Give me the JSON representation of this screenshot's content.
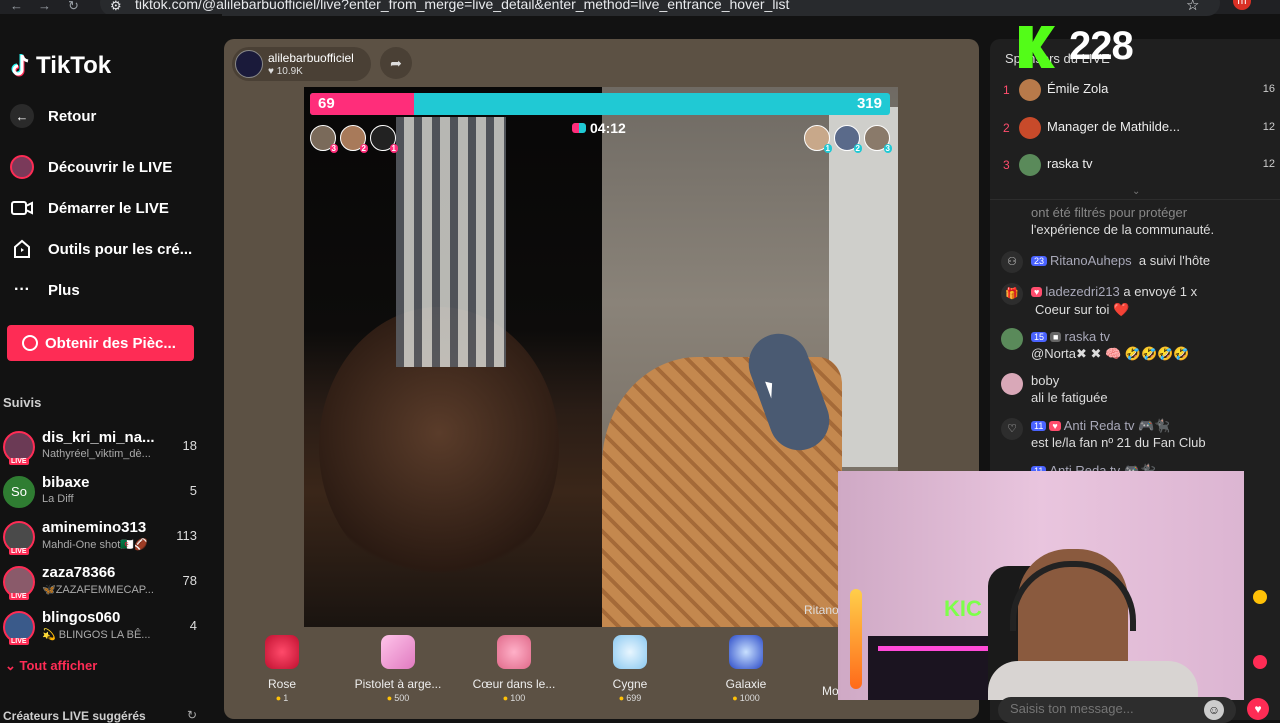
{
  "browser": {
    "url": "tiktok.com/@alilebarbuofficiel/live?enter_from_merge=live_detail&enter_method=live_entrance_hover_list",
    "profile_initial": "m"
  },
  "sidebar": {
    "logo": "TikTok",
    "nav": [
      {
        "label": "Retour",
        "icon": "arrow-left-icon"
      },
      {
        "label": "Découvrir le LIVE",
        "icon": "live-discover-icon"
      },
      {
        "label": "Démarrer le LIVE",
        "icon": "video-camera-icon"
      },
      {
        "label": "Outils pour les cré...",
        "icon": "creator-tools-icon"
      },
      {
        "label": "Plus",
        "icon": "more-dots-icon"
      }
    ],
    "coins_button": "Obtenir des Pièc...",
    "following_title": "Suivis",
    "following": [
      {
        "name": "dis_kri_mi_na...",
        "sub": "Nathyréel_viktim_dè...",
        "count": "18",
        "avatar_color": "#6b3a55"
      },
      {
        "name": "bibaxe",
        "sub": "La Diff",
        "count": "5",
        "avatar_color": "#2f7d32",
        "initials": "So"
      },
      {
        "name": "aminemino313",
        "sub": "Mahdi-One shot🇩🇿🏈",
        "count": "113",
        "avatar_color": "#4a4a4a"
      },
      {
        "name": "zaza78366",
        "sub": "🦋ZAZAFEMMECAP...",
        "count": "78",
        "avatar_color": "#8a5a6a"
      },
      {
        "name": "blingos060",
        "sub": "💫 BLINGOS LA BÊ...",
        "count": "4",
        "avatar_color": "#3a5a8a"
      }
    ],
    "see_all": "Tout afficher",
    "suggested_title": "Créateurs LIVE suggérés"
  },
  "live": {
    "host_name": "alilebarbuofficiel",
    "host_likes": "10.9K",
    "battle": {
      "left_score": "69",
      "right_score": "319",
      "left_share": 0.18,
      "timer": "04:12"
    },
    "left_team_ranks": [
      "3",
      "2",
      "1"
    ],
    "right_team_ranks": [
      "1",
      "2",
      "3"
    ],
    "watermark": "Ritano",
    "gifts": [
      {
        "name": "Rose",
        "price": "1",
        "color": "#e0284a"
      },
      {
        "name": "Pistolet à arge...",
        "price": "500",
        "color": "#f39ad2"
      },
      {
        "name": "Cœur dans le...",
        "price": "100",
        "color": "#f08fa8"
      },
      {
        "name": "Cygne",
        "price": "699",
        "color": "#a9d9ff"
      },
      {
        "name": "Galaxie",
        "price": "1000",
        "color": "#4a6cff"
      }
    ],
    "more_label": "Mo"
  },
  "chat": {
    "kick_viewers": "228",
    "sponsors_title": "Sponsors du LIVE",
    "ranking": [
      {
        "rank": "1",
        "name": "Émile Zola",
        "score": "16",
        "avatar_color": "#b87a4a"
      },
      {
        "rank": "2",
        "name": "Manager de Mathilde...",
        "score": "12",
        "avatar_color": "#c84a2a"
      },
      {
        "rank": "3",
        "name": "raska tv",
        "score": "12",
        "avatar_color": "#5a8a5a"
      }
    ],
    "system_notice_line1": "ont été filtrés pour protéger",
    "system_notice_line2": "l'expérience de la communauté.",
    "messages": [
      {
        "badge": "23",
        "user": "RitanoAuheps",
        "text": "a suivi l'hôte",
        "icon": "person-icon"
      },
      {
        "user": "ladezedri213",
        "text": "a envoyé 1 x",
        "text2": "Coeur sur toi ❤️",
        "icon": "gift-icon"
      },
      {
        "badge": "15",
        "user": "raska tv",
        "text": "@Norta✖ ✖ 🧠 🤣🤣🤣🤣",
        "icon": "avatar"
      },
      {
        "user": "boby",
        "text": "ali le fatiguée",
        "icon": "avatar"
      },
      {
        "badge": "11",
        "user": "Anti Reda tv 🎮🐈‍⬛",
        "text": "est le/la fan nº 21 du Fan Club",
        "icon": "heart-outline-icon"
      },
      {
        "badge": "11",
        "user": "Anti Reda tv 🎮🐈‍⬛",
        "text": "",
        "icon": "heart-outline-icon"
      }
    ],
    "input_placeholder": "Saisis ton message..."
  },
  "webcam": {
    "sign_text": "KIC"
  }
}
